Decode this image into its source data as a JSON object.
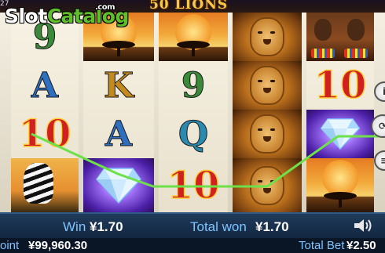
{
  "header": {
    "corner_number": "27",
    "game_title": "50 LIONS"
  },
  "logo": {
    "slot": "Slot",
    "catalog": "Catalog",
    "com": ".com"
  },
  "reels": {
    "reel1": [
      "9",
      "A",
      "10",
      "zebra"
    ],
    "reel2": [
      "sunset",
      "K",
      "A",
      "diamond"
    ],
    "reel3": [
      "sunset",
      "9",
      "Q",
      "10"
    ],
    "reel4": [
      "lion",
      "lion",
      "lion",
      "lion"
    ],
    "reel5": [
      "warriors",
      "10",
      "diamond",
      "sunset"
    ]
  },
  "symbols": {
    "nine": "9",
    "ace": "A",
    "king": "K",
    "queen": "Q",
    "ten": "10"
  },
  "win_line_color": "#6ee04a",
  "bottom_bar": {
    "win_label": "Win",
    "win_value": "¥1.70",
    "total_won_label": "Total won",
    "total_won_value": "¥1.70"
  },
  "status_bar": {
    "point_label": "oint",
    "point_value": "¥99,960.30",
    "total_bet_label": "Total Bet",
    "total_bet_value": "¥2.50"
  },
  "icons": {
    "sound": "speaker-icon",
    "side_top": "info-icon",
    "side_middle": "spin-icon",
    "side_bottom": "settings-icon"
  }
}
